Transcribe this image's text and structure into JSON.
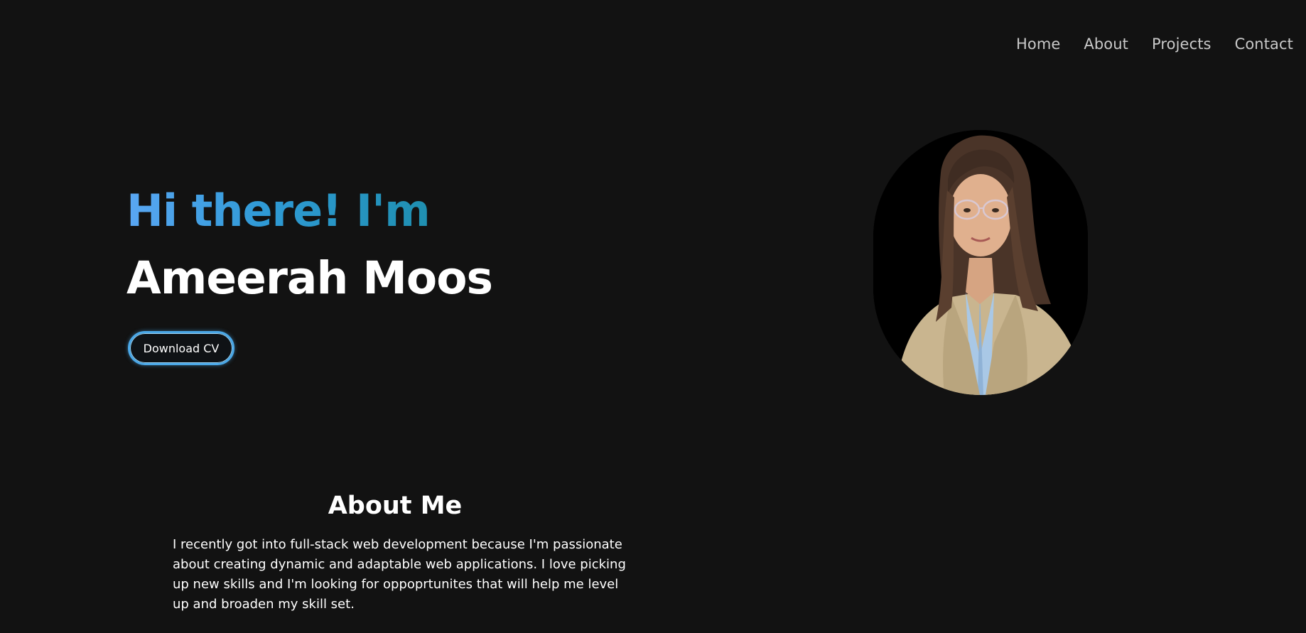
{
  "nav": {
    "items": [
      {
        "label": "Home"
      },
      {
        "label": "About"
      },
      {
        "label": "Projects"
      },
      {
        "label": "Contact"
      }
    ]
  },
  "hero": {
    "greeting": "Hi there! I'm",
    "name": "Ameerah Moos",
    "cta_label": "Download CV",
    "portrait_alt": "portrait-photo"
  },
  "about": {
    "title": "About Me",
    "body": "I recently got into full-stack web development because I'm passionate about creating dynamic and adaptable web applications. I love picking up new skills and I'm looking for oppoprtunites that will help me level up and broaden my skill set."
  },
  "colors": {
    "background": "#121212",
    "accent_start": "#5aa7f4",
    "accent_end": "#1f8fb0",
    "nav_text": "#c9c9c9"
  }
}
